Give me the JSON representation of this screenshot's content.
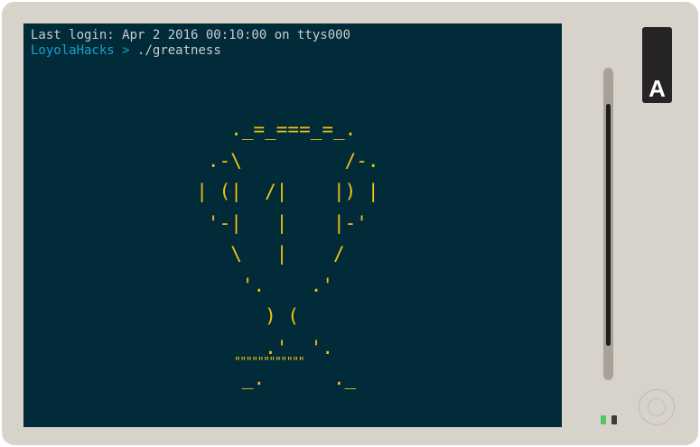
{
  "terminal": {
    "last_login": "Last login: Apr 2 2016 00:10:00 on ttys000",
    "prompt_host": "LoyolaHacks",
    "prompt_symbol": ">",
    "command": "./greatness",
    "ascii_trophy": "     ._=_===_=_.\n   .-\\         /-.\n  | (|  /|    |) |\n   '-|   |    |-'\n     \\   |    /\n      '.    .'\n        ) (\n        .'  '.\n      _.      ._",
    "trophy_base": "\"\"\"\"\"\"\"\"\"\"\"\""
  },
  "side_badge": {
    "letter": "A"
  },
  "colors": {
    "screen_bg": "#022b3a",
    "ascii_art": "#f2c30f",
    "prompt": "#1b9fcf",
    "frame": "#d8d3ca",
    "led_green": "#4cc764"
  }
}
